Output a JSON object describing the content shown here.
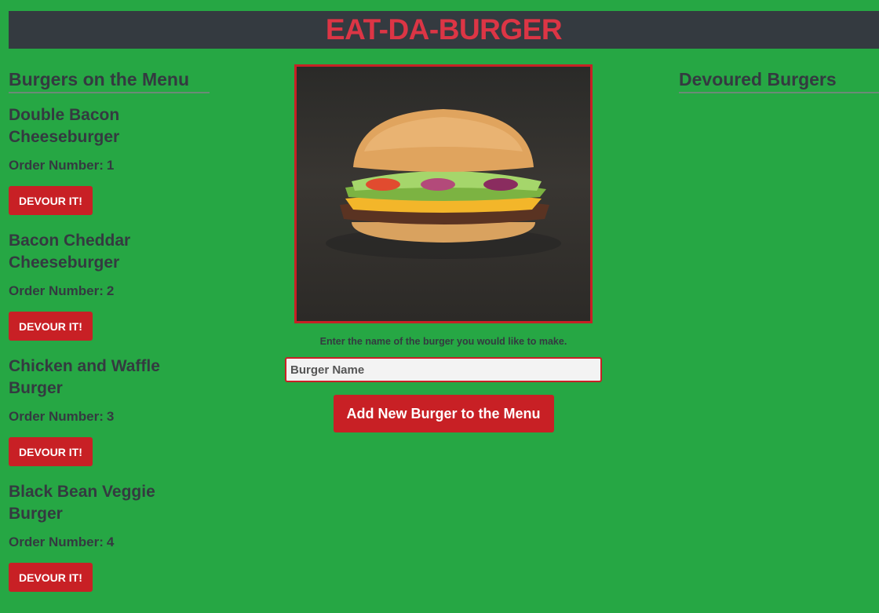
{
  "header": {
    "title": "EAT-DA-BURGER"
  },
  "menu": {
    "title": "Burgers on the Menu",
    "order_label": "Order Number:",
    "devour_label": "DEVOUR IT!",
    "items": [
      {
        "name": "Double Bacon Cheeseburger",
        "order": "1"
      },
      {
        "name": "Bacon Cheddar Cheeseburger",
        "order": "2"
      },
      {
        "name": "Chicken and Waffle Burger",
        "order": "3"
      },
      {
        "name": "Black Bean Veggie Burger",
        "order": "4"
      }
    ]
  },
  "form": {
    "image_icon": "burger-photo",
    "helper_text": "Enter the name of the burger you would like to make.",
    "input_placeholder": "Burger Name",
    "input_value": "",
    "submit_label": "Add New Burger to the Menu"
  },
  "devoured": {
    "title": "Devoured Burgers",
    "items": []
  },
  "colors": {
    "background": "#26a744",
    "header_bg": "#343a40",
    "title_red": "#dc3545",
    "button_red": "#c82025",
    "text_dark": "#343a40"
  }
}
